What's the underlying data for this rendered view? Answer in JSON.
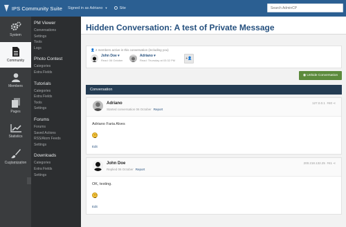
{
  "topbar": {
    "brand": "IPS Community Suite",
    "signed_in": "Signed in as Adriano",
    "site_link": "Site",
    "search_placeholder": "Search AdminCP"
  },
  "iconbar": {
    "items": [
      {
        "label": "System",
        "icon": "gears-icon"
      },
      {
        "label": "Community",
        "icon": "document-icon",
        "active": true
      },
      {
        "label": "Members",
        "icon": "user-icon"
      },
      {
        "label": "Pages",
        "icon": "pages-icon"
      },
      {
        "label": "Statistics",
        "icon": "chart-icon"
      },
      {
        "label": "Customization",
        "icon": "brush-icon"
      }
    ],
    "restore": "Restore"
  },
  "submenu": {
    "groups": [
      {
        "title": "PM Viewer",
        "links": [
          "Conversations",
          "Settings",
          "Tools",
          "Logs"
        ]
      },
      {
        "title": "Photo Contest",
        "links": [
          "Categories",
          "Extra Fields"
        ]
      },
      {
        "title": "Tutorials",
        "links": [
          "Categories",
          "Extra Fields",
          "Tools",
          "Settings"
        ]
      },
      {
        "title": "Forums",
        "links": [
          "Forums",
          "Saved Actions",
          "RSS/Atom Feeds",
          "Settings"
        ]
      },
      {
        "title": "Downloads",
        "links": [
          "Categories",
          "Extra Fields",
          "Settings"
        ]
      }
    ]
  },
  "page": {
    "title": "Hidden Conversation: A test of Private Message"
  },
  "members_box": {
    "count_text": "2 members active in this conversation (including you)",
    "members": [
      {
        "name": "John Doe",
        "sub": "Read: 06 October"
      },
      {
        "name": "Adriano",
        "sub": "Read: Thursday at 03:32 PM"
      }
    ],
    "add_label": "+"
  },
  "unhide_button": "Unhide Conversation",
  "conversation_header": "Conversation",
  "posts": [
    {
      "author": "Adriano",
      "meta": "Started conversation 06 October",
      "report": "Report",
      "ip": "127.0.0.1",
      "post_no": "#40",
      "text": "Adriano Faria Alves",
      "edit": "Edit"
    },
    {
      "author": "John Doe",
      "meta": "Replied 06 October",
      "report": "Report",
      "ip": "200.218.132.25",
      "post_no": "#41",
      "text": "OK, testing.",
      "edit": "Edit"
    }
  ],
  "colors": {
    "topbar": "#2b5f92",
    "iconbar": "#3a3c3e",
    "submenu": "#2c2e30",
    "conv_header": "#243c53",
    "unhide": "#5c8a3c"
  }
}
